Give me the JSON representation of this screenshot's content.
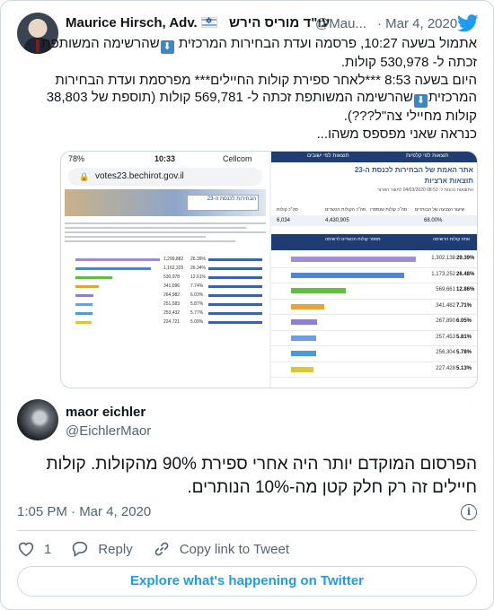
{
  "quoted": {
    "name": "Maurice Hirsch, Adv.",
    "name_hebrew": "עו\"ד מוריס הירש",
    "handle": "@Mau...",
    "date": "· Mar 4, 2020",
    "text_1": "אתמול בשעה 10:27, פרסמה ועדת הבחירות המרכזית ",
    "text_2": "שהרשימה המשותפת\nזכתה ל- 530,978 קולות.\nהיום בשעה 8:53 ***לאחר ספירת קולות החיילים*** מפרסמת ועדת הבחירות\nהמרכזית",
    "text_3": "שהרשימה המשותפת זכתה ל- 569,781 קולות (תוספת של 38,803\nקולות מחיילי צה\"ל???).\nכנראה שאני מפספס משהו..."
  },
  "media": {
    "phone": {
      "battery": "78%",
      "time": "10:33",
      "carrier": "Cellcom",
      "url": "votes23.bechirot.gov.il",
      "banner": "הבחירות לכנסת ה-23",
      "rows": [
        {
          "num": "1,299,882",
          "pct": "26.39%",
          "color": "#9b8bd2",
          "frac": 0.78
        },
        {
          "num": "1,162,325",
          "pct": "26.34%",
          "color": "#4e83d0",
          "frac": 0.7
        },
        {
          "num": "530,978",
          "pct": "12.61%",
          "color": "#5cbf3d",
          "frac": 0.34
        },
        {
          "num": "341,096",
          "pct": "7.74%",
          "color": "#e3a437",
          "frac": 0.22
        },
        {
          "num": "264,982",
          "pct": "6.03%",
          "color": "#8a7fd0",
          "frac": 0.17
        },
        {
          "num": "251,583",
          "pct": "5.87%",
          "color": "#6d9ee0",
          "frac": 0.16
        },
        {
          "num": "253,432",
          "pct": "5.77%",
          "color": "#4b9bd6",
          "frac": 0.16
        },
        {
          "num": "224,721",
          "pct": "5.09%",
          "color": "#d9c640",
          "frac": 0.15
        }
      ]
    },
    "desktop": {
      "tab_1": "תוצאות לפי ישובים",
      "tab_2": "תוצאות לפי קלפיות",
      "title": "אתר האמת של הבחירות לכנסת ה-23",
      "subtitle": "תוצאות ארציות",
      "note": "התוצאות נכונות ל: 08:53 04/03/2020 לתוצר הארצי",
      "stat_labels": [
        "סה\"כ קולות",
        "סה\"כ הקולות הכשרים",
        "סה\"כ קולות שנספרו",
        "שיעור הצבעה של הבוחרים"
      ],
      "stat_values": [
        "6,034",
        "4,430,905",
        "",
        "68.00%"
      ],
      "th_pct": "אחוז קולות הרשימה",
      "th_votes": "מספר קולות הכשרים לרשימה",
      "rows": [
        {
          "num": "1,302,138",
          "pct": "29.39%",
          "color": "#a08fd6",
          "frac": 0.82
        },
        {
          "num": "1,173,252",
          "pct": "26.48%",
          "color": "#4f86d2",
          "frac": 0.74
        },
        {
          "num": "569,661",
          "pct": "12.86%",
          "color": "#5fc03f",
          "frac": 0.36
        },
        {
          "num": "341,482",
          "pct": "7.71%",
          "color": "#e6a538",
          "frac": 0.22
        },
        {
          "num": "267,890",
          "pct": "6.05%",
          "color": "#8b80d2",
          "frac": 0.17
        },
        {
          "num": "257,453",
          "pct": "5.81%",
          "color": "#6e9fe1",
          "frac": 0.165
        },
        {
          "num": "256,304",
          "pct": "5.78%",
          "color": "#4a9ad6",
          "frac": 0.164
        },
        {
          "num": "227,428",
          "pct": "5.13%",
          "color": "#d8c63f",
          "frac": 0.145
        }
      ]
    }
  },
  "reply": {
    "name": "maor eichler",
    "handle": "@EichlerMaor",
    "text": "הפרסום המוקדם יותר היה אחרי ספירת 90% מהקולות. קולות\nחיילים זה רק חלק קטן מה-10% הנותרים.",
    "time": "1:05 PM · Mar 4, 2020"
  },
  "actions": {
    "like_count": "1",
    "reply_label": "Reply",
    "copy_label": "Copy link to Tweet",
    "explore_label": "Explore what's happening on Twitter"
  },
  "colors": {
    "twitter_blue": "#1d9bf0",
    "secondary_text": "#536471",
    "border": "#cfd9de"
  }
}
